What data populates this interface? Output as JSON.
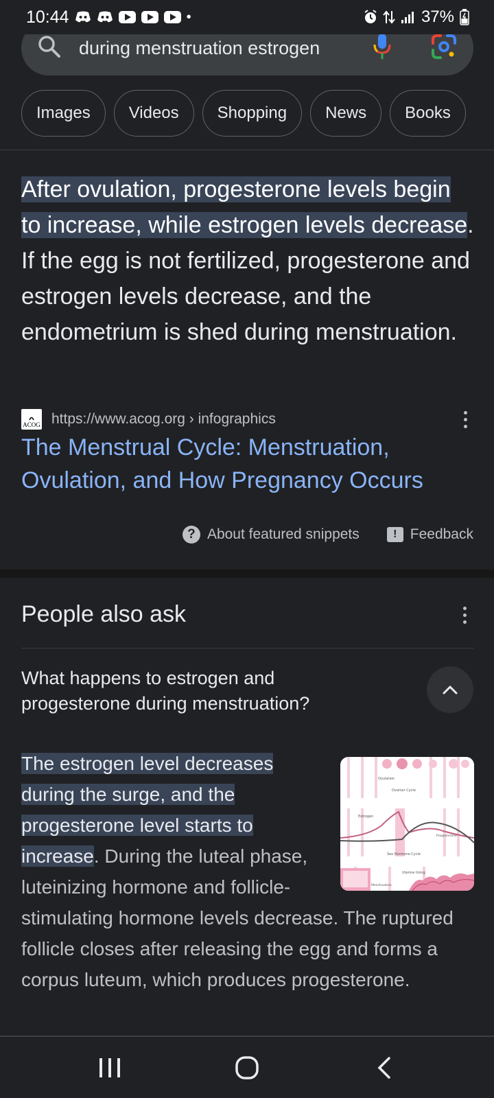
{
  "status_bar": {
    "time": "10:44",
    "battery": "37%",
    "icons": [
      "discord-icon",
      "discord-icon",
      "youtube-icon",
      "youtube-icon",
      "youtube-icon",
      "notification-dot",
      "alarm-icon",
      "data-arrows-icon",
      "signal-icon",
      "battery-icon"
    ]
  },
  "search": {
    "query": "during menstruation estrogen"
  },
  "chips": [
    "Images",
    "Videos",
    "Shopping",
    "News",
    "Books"
  ],
  "featured_snippet": {
    "highlighted": "After ovulation, progesterone levels begin to increase, while estrogen levels decrease",
    "rest": ". If the egg is not fertilized, progesterone and estrogen levels decrease, and the endometrium is shed during menstruation.",
    "favicon_text": "ACOG",
    "source_url": "https://www.acog.org › infographics",
    "title": "The Menstrual Cycle: Menstruation, Ovulation, and How Pregnancy Occurs",
    "about_label": "About featured snippets",
    "feedback_label": "Feedback"
  },
  "people_also_ask": {
    "title": "People also ask",
    "question": "What happens to estrogen and progesterone during menstruation?",
    "answer_highlighted": "The estrogen level decreases during the surge, and the progesterone level starts to increase",
    "answer_rest": ". During the luteal phase, luteinizing hormone and follicle-stimulating hormone levels decrease. The ruptured follicle closes after releasing the egg and forms a corpus luteum, which produces progesterone.",
    "thumbnail_labels": [
      "Ovulation",
      "Ovarian Cycle",
      "Estrogen",
      "Progesterone",
      "Sex Hormone Cycle",
      "Uterine lining",
      "Menstruation"
    ]
  },
  "nav_bar": {
    "buttons": [
      "recent-apps-button",
      "home-button",
      "back-button"
    ]
  }
}
